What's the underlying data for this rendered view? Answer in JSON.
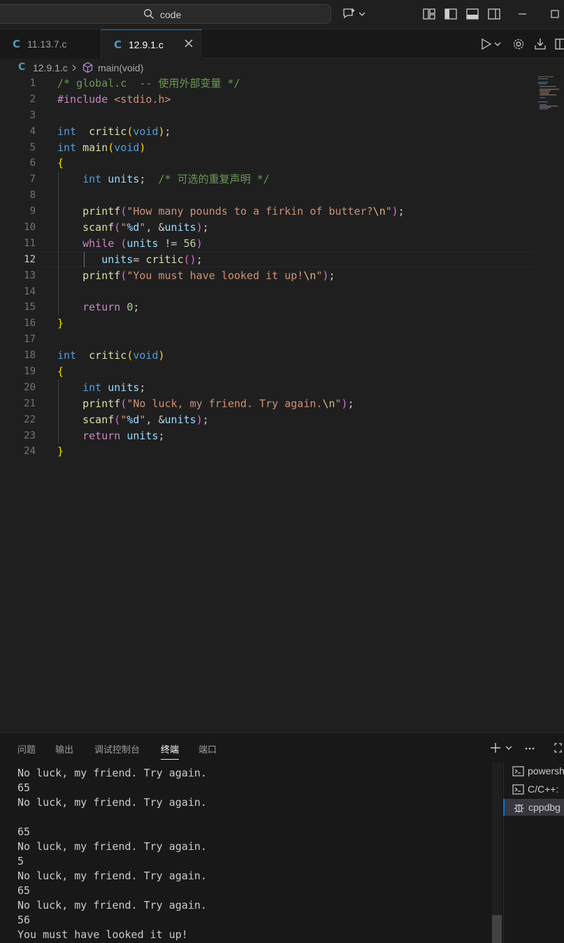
{
  "titlebar": {
    "search_text": "code"
  },
  "tabs": [
    {
      "label": "11.13.7.c",
      "icon": "C"
    },
    {
      "label": "12.9.1.c",
      "icon": "C"
    }
  ],
  "breadcrumb": {
    "icon": "C",
    "file": "12.9.1.c",
    "symbol": "main(void)"
  },
  "editor": {
    "active_line": 12,
    "line_numbers": [
      "1",
      "2",
      "3",
      "4",
      "5",
      "6",
      "7",
      "8",
      "9",
      "10",
      "11",
      "12",
      "13",
      "14",
      "15",
      "16",
      "17",
      "18",
      "19",
      "20",
      "21",
      "22",
      "23",
      "24"
    ],
    "lines": [
      [
        {
          "t": "/* global.c  -- 使用外部变量 */",
          "c": "cmt"
        }
      ],
      [
        {
          "t": "#include ",
          "c": "ctl"
        },
        {
          "t": "<stdio.h>",
          "c": "str"
        }
      ],
      [],
      [
        {
          "t": "int",
          "c": "kw"
        },
        {
          "t": "  ",
          "c": "pl"
        },
        {
          "t": "critic",
          "c": "fn"
        },
        {
          "t": "(",
          "c": "br1"
        },
        {
          "t": "void",
          "c": "kw"
        },
        {
          "t": ")",
          "c": "br1"
        },
        {
          "t": ";",
          "c": "pl"
        }
      ],
      [
        {
          "t": "int",
          "c": "kw"
        },
        {
          "t": " ",
          "c": "pl"
        },
        {
          "t": "main",
          "c": "fn"
        },
        {
          "t": "(",
          "c": "br1"
        },
        {
          "t": "void",
          "c": "kw"
        },
        {
          "t": ")",
          "c": "br1"
        }
      ],
      [
        {
          "t": "{",
          "c": "br1"
        }
      ],
      [
        {
          "t": "    ",
          "c": "pl"
        },
        {
          "t": "int",
          "c": "kw"
        },
        {
          "t": " ",
          "c": "pl"
        },
        {
          "t": "units",
          "c": "var"
        },
        {
          "t": ";  ",
          "c": "pl"
        },
        {
          "t": "/* 可选的重复声明 */",
          "c": "cmt"
        }
      ],
      [],
      [
        {
          "t": "    ",
          "c": "pl"
        },
        {
          "t": "printf",
          "c": "fn"
        },
        {
          "t": "(",
          "c": "br2"
        },
        {
          "t": "\"How many pounds to a firkin of butter?",
          "c": "str"
        },
        {
          "t": "\\n",
          "c": "esc"
        },
        {
          "t": "\"",
          "c": "str"
        },
        {
          "t": ")",
          "c": "br2"
        },
        {
          "t": ";",
          "c": "pl"
        }
      ],
      [
        {
          "t": "    ",
          "c": "pl"
        },
        {
          "t": "scanf",
          "c": "fn"
        },
        {
          "t": "(",
          "c": "br2"
        },
        {
          "t": "\"",
          "c": "str"
        },
        {
          "t": "%d",
          "c": "var"
        },
        {
          "t": "\"",
          "c": "str"
        },
        {
          "t": ", &",
          "c": "pl"
        },
        {
          "t": "units",
          "c": "var"
        },
        {
          "t": ")",
          "c": "br2"
        },
        {
          "t": ";",
          "c": "pl"
        }
      ],
      [
        {
          "t": "    ",
          "c": "pl"
        },
        {
          "t": "while",
          "c": "ctl"
        },
        {
          "t": " ",
          "c": "pl"
        },
        {
          "t": "(",
          "c": "br2"
        },
        {
          "t": "units",
          "c": "var"
        },
        {
          "t": " != ",
          "c": "pl"
        },
        {
          "t": "56",
          "c": "num"
        },
        {
          "t": ")",
          "c": "br2"
        }
      ],
      [
        {
          "t": "       ",
          "c": "pl"
        },
        {
          "t": "units",
          "c": "var"
        },
        {
          "t": "= ",
          "c": "pl"
        },
        {
          "t": "critic",
          "c": "fn"
        },
        {
          "t": "()",
          "c": "br2"
        },
        {
          "t": ";",
          "c": "pl"
        }
      ],
      [
        {
          "t": "    ",
          "c": "pl"
        },
        {
          "t": "printf",
          "c": "fn"
        },
        {
          "t": "(",
          "c": "br2"
        },
        {
          "t": "\"You must have looked it up!",
          "c": "str"
        },
        {
          "t": "\\n",
          "c": "esc"
        },
        {
          "t": "\"",
          "c": "str"
        },
        {
          "t": ")",
          "c": "br2"
        },
        {
          "t": ";",
          "c": "pl"
        }
      ],
      [],
      [
        {
          "t": "    ",
          "c": "pl"
        },
        {
          "t": "return",
          "c": "ctl"
        },
        {
          "t": " ",
          "c": "pl"
        },
        {
          "t": "0",
          "c": "num"
        },
        {
          "t": ";",
          "c": "pl"
        }
      ],
      [
        {
          "t": "}",
          "c": "br1"
        }
      ],
      [],
      [
        {
          "t": "int",
          "c": "kw"
        },
        {
          "t": "  ",
          "c": "pl"
        },
        {
          "t": "critic",
          "c": "fn"
        },
        {
          "t": "(",
          "c": "br1"
        },
        {
          "t": "void",
          "c": "kw"
        },
        {
          "t": ")",
          "c": "br1"
        }
      ],
      [
        {
          "t": "{",
          "c": "br1"
        }
      ],
      [
        {
          "t": "    ",
          "c": "pl"
        },
        {
          "t": "int",
          "c": "kw"
        },
        {
          "t": " ",
          "c": "pl"
        },
        {
          "t": "units",
          "c": "var"
        },
        {
          "t": ";",
          "c": "pl"
        }
      ],
      [
        {
          "t": "    ",
          "c": "pl"
        },
        {
          "t": "printf",
          "c": "fn"
        },
        {
          "t": "(",
          "c": "br2"
        },
        {
          "t": "\"No luck, my friend. Try again.",
          "c": "str"
        },
        {
          "t": "\\n",
          "c": "esc"
        },
        {
          "t": "\"",
          "c": "str"
        },
        {
          "t": ")",
          "c": "br2"
        },
        {
          "t": ";",
          "c": "pl"
        }
      ],
      [
        {
          "t": "    ",
          "c": "pl"
        },
        {
          "t": "scanf",
          "c": "fn"
        },
        {
          "t": "(",
          "c": "br2"
        },
        {
          "t": "\"",
          "c": "str"
        },
        {
          "t": "%d",
          "c": "var"
        },
        {
          "t": "\"",
          "c": "str"
        },
        {
          "t": ", &",
          "c": "pl"
        },
        {
          "t": "units",
          "c": "var"
        },
        {
          "t": ")",
          "c": "br2"
        },
        {
          "t": ";",
          "c": "pl"
        }
      ],
      [
        {
          "t": "    ",
          "c": "pl"
        },
        {
          "t": "return",
          "c": "ctl"
        },
        {
          "t": " ",
          "c": "pl"
        },
        {
          "t": "units",
          "c": "var"
        },
        {
          "t": ";",
          "c": "pl"
        }
      ],
      [
        {
          "t": "}",
          "c": "br1"
        }
      ]
    ]
  },
  "panel": {
    "tabs": [
      "问题",
      "输出",
      "调试控制台",
      "终端",
      "端口"
    ],
    "active_tab": "终端",
    "terminal_lines": [
      "No luck, my friend. Try again.",
      "65",
      "No luck, my friend. Try again.",
      "",
      "65",
      "No luck, my friend. Try again.",
      "5",
      "No luck, my friend. Try again.",
      "65",
      "No luck, my friend. Try again.",
      "56",
      "You must have looked it up!"
    ],
    "terminals": [
      {
        "label": "powershell",
        "icon": "terminal-icon"
      },
      {
        "label": "C/C++:",
        "icon": "terminal-icon"
      },
      {
        "label": "cppdbg",
        "icon": "debug-icon"
      }
    ]
  },
  "colors": {
    "background": "#1f1f1f",
    "accent": "#0078d4",
    "c_icon": "#519aba"
  }
}
